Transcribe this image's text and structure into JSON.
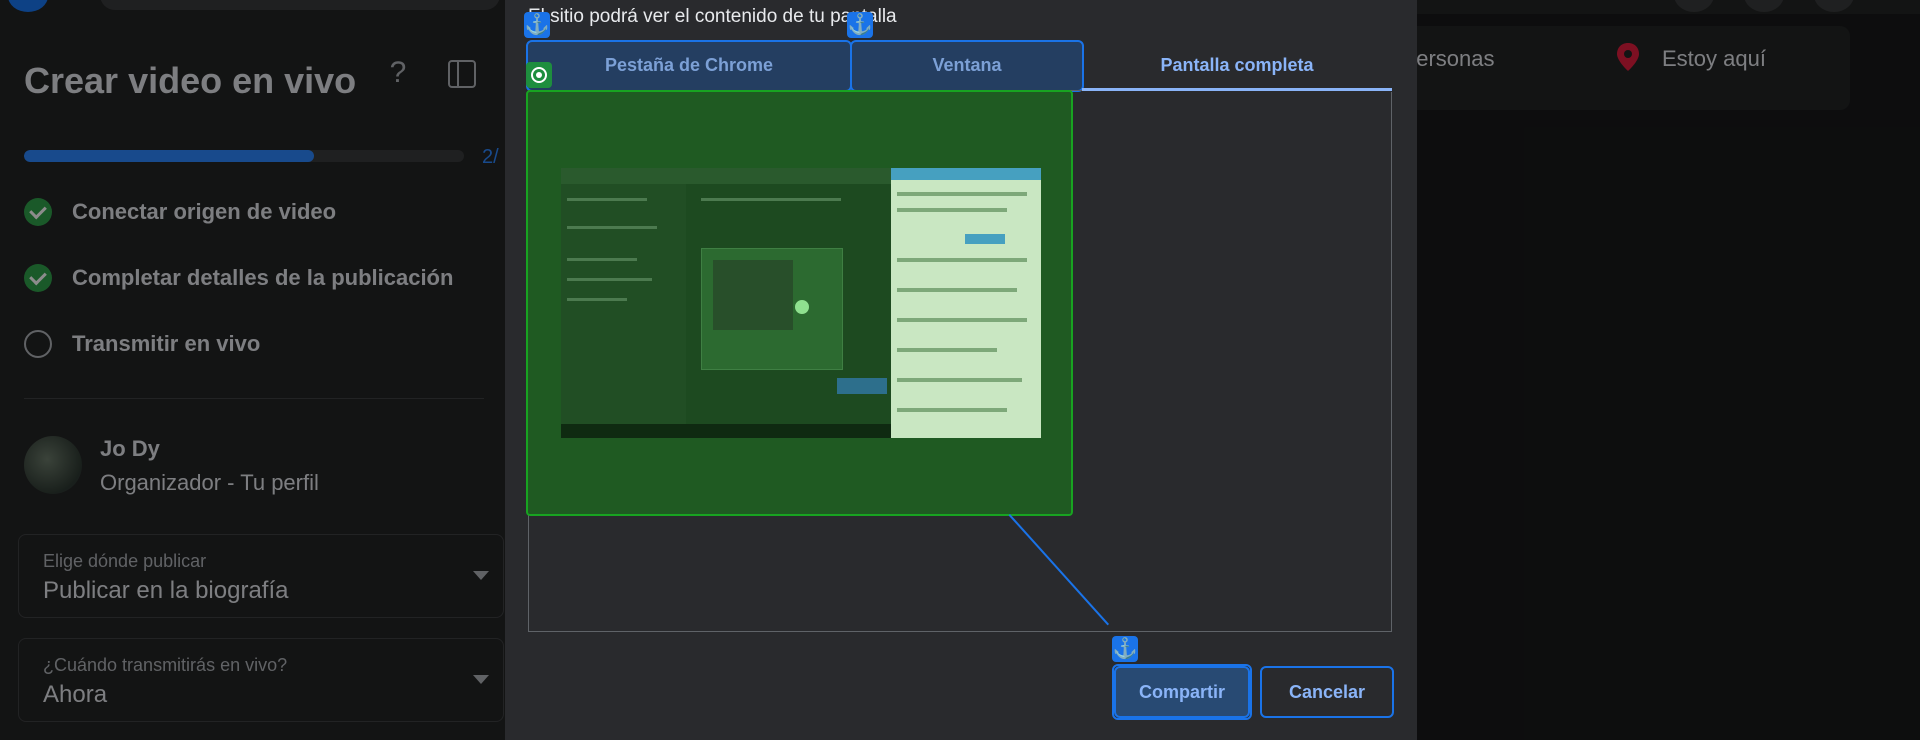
{
  "background": {
    "title": "Crear video en vivo",
    "progress": {
      "fraction": 0.66,
      "text": "2/"
    },
    "steps": [
      {
        "label": "Conectar origen de video",
        "state": "done"
      },
      {
        "label": "Completar detalles de la publicación",
        "state": "done"
      },
      {
        "label": "Transmitir en vivo",
        "state": "todo"
      }
    ],
    "user": {
      "name": "Jo Dy",
      "subtitle": "Organizador - Tu perfil"
    },
    "publish_select": {
      "caption": "Elige dónde publicar",
      "value": "Publicar en la biografía"
    },
    "when_select": {
      "caption": "¿Cuándo transmitirás en vivo?",
      "value": "Ahora"
    },
    "right_bar": {
      "people_text": "personas",
      "location_text": "Estoy aquí"
    },
    "colors": {
      "accent": "#2d88ff",
      "success": "#31a24c",
      "pin": "#e41e3f"
    }
  },
  "dialog": {
    "message": "El sitio podrá ver el contenido de tu pantalla",
    "tabs": [
      {
        "label": "Pestaña de Chrome",
        "selected": false
      },
      {
        "label": "Ventana",
        "selected": false
      },
      {
        "label": "Pantalla completa",
        "selected": true
      }
    ],
    "preview_icon": "screen-thumbnail",
    "share_label": "Compartir",
    "cancel_label": "Cancelar"
  },
  "overlay": {
    "anchor_icon": "⚓",
    "colors": {
      "highlight": "#1a73e8",
      "preview_highlight": "#18a321"
    }
  }
}
